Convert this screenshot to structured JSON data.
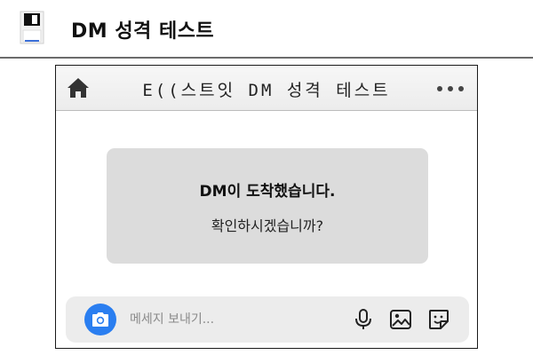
{
  "header": {
    "title": "DM 성격 테스트",
    "icon": "floppy-disk-icon"
  },
  "phone": {
    "chat_title": "E((스트잇 DM 성격 테스트",
    "left_icon": "home-icon",
    "right_icon": "more-horizontal-icon"
  },
  "dm_card": {
    "line1": "DM이 도착했습니다.",
    "line2": "확인하시겠습니까?"
  },
  "composer": {
    "placeholder": "메세지 보내기...",
    "value": "",
    "icons": [
      "camera-icon",
      "microphone-icon",
      "image-icon",
      "sticker-icon"
    ],
    "camera_color": "#2a7ef0"
  }
}
